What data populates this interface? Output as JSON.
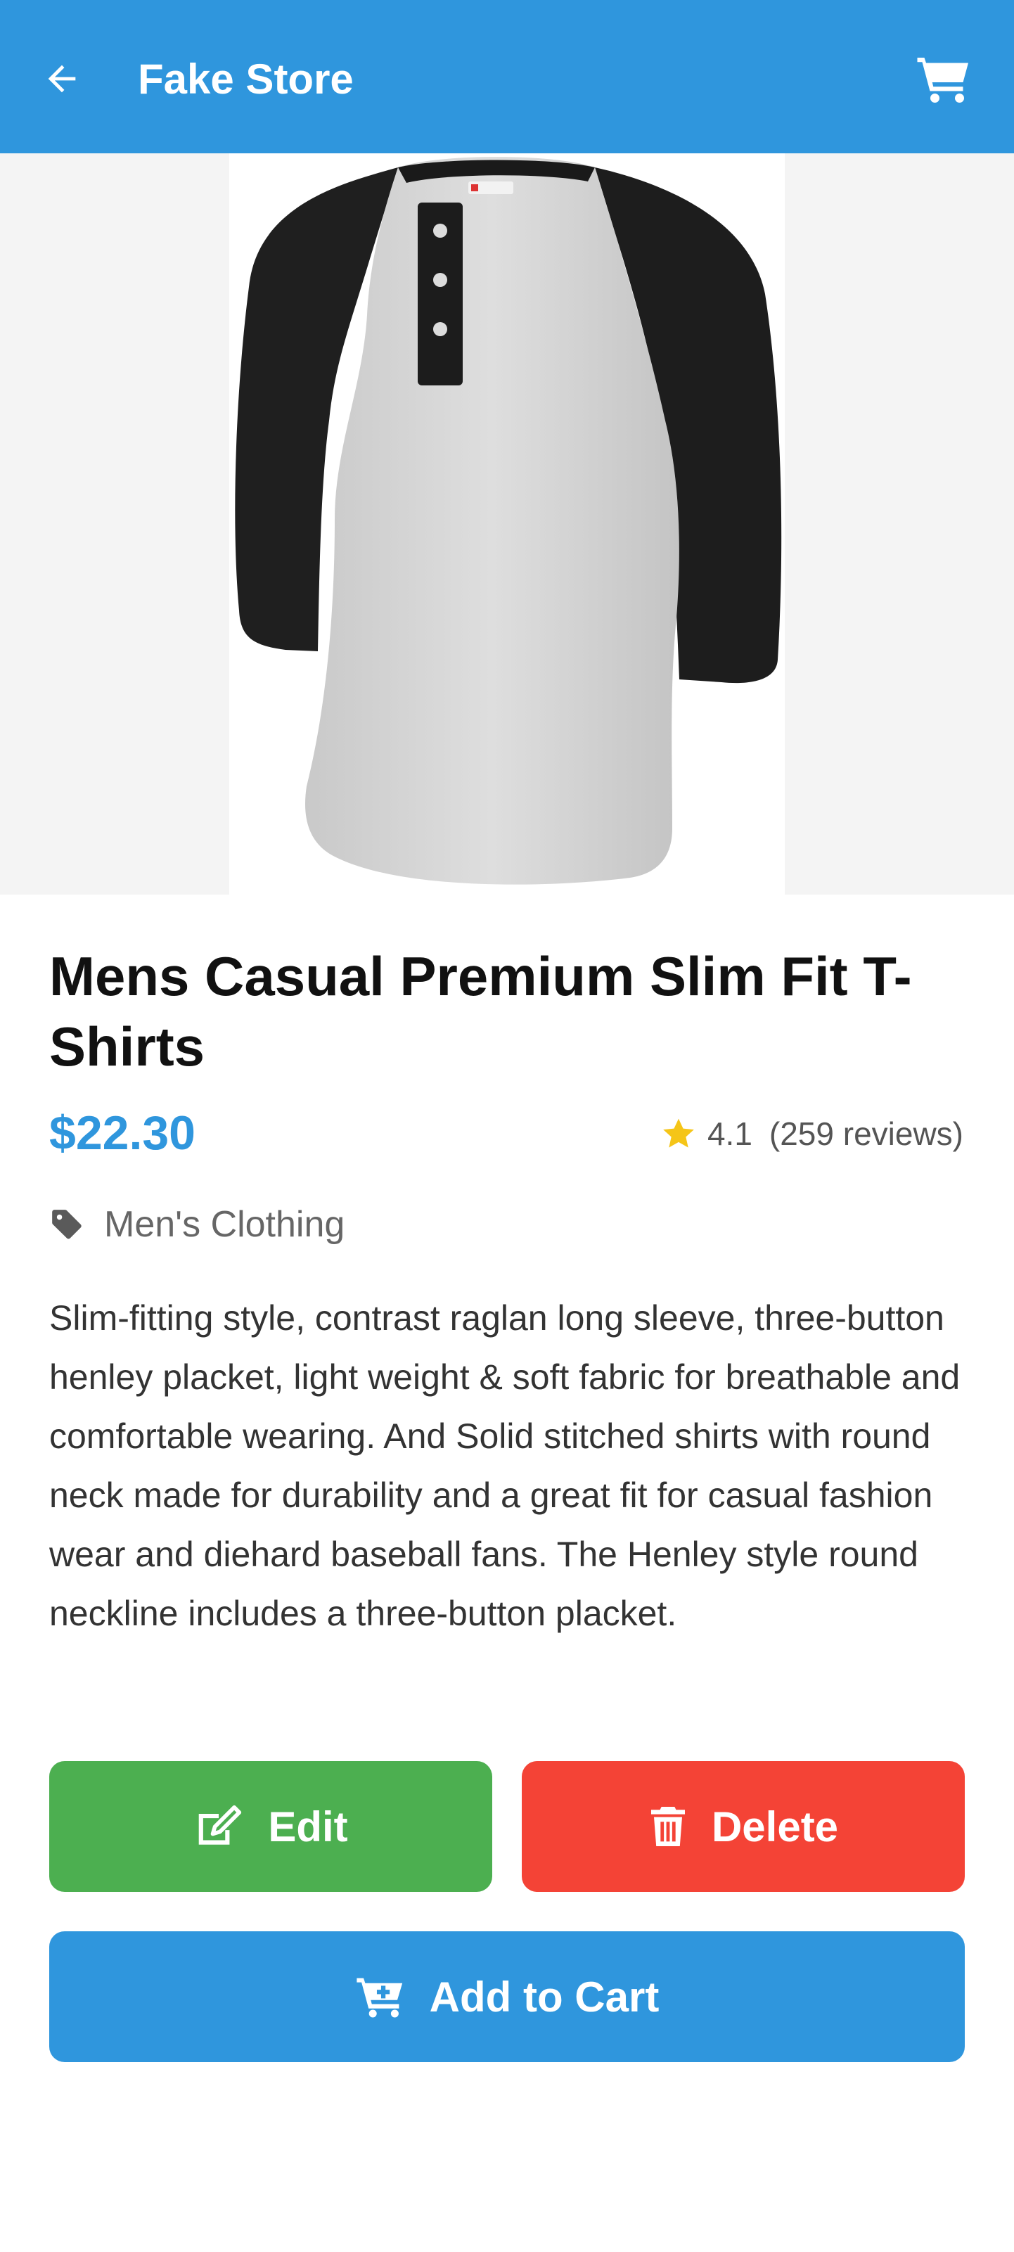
{
  "appbar": {
    "title": "Fake Store",
    "back_icon": "arrow-left-icon",
    "cart_icon": "shopping-cart-icon"
  },
  "product": {
    "title": "Mens Casual Premium Slim Fit T-Shirts",
    "price": "$22.30",
    "rating": {
      "value": "4.1",
      "reviews": "(259 reviews)",
      "icon": "star-icon"
    },
    "category": {
      "label": "Men's Clothing",
      "icon": "tag-icon"
    },
    "description": "Slim-fitting style, contrast raglan long sleeve, three-button henley placket, light weight & soft fabric for breathable and comfortable wearing. And Solid stitched shirts with round neck made for durability and a great fit for casual fashion wear and diehard baseball fans. The Henley style round neckline includes a three-button placket."
  },
  "actions": {
    "edit_label": "Edit",
    "delete_label": "Delete",
    "add_to_cart_label": "Add to Cart"
  },
  "colors": {
    "primary": "#2f96dd",
    "edit": "#4caf50",
    "delete": "#f44336",
    "star": "#f5c518"
  }
}
